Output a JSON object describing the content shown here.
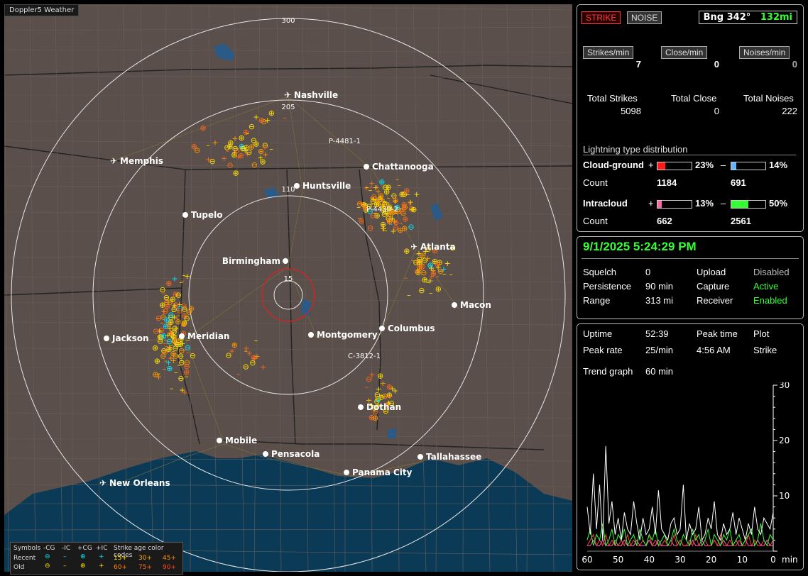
{
  "window_title": "Doppler5 Weather",
  "map": {
    "cities": [
      {
        "name": "Nashville",
        "airport": true
      },
      {
        "name": "Memphis",
        "airport": true
      },
      {
        "name": "Chattanooga",
        "airport": false
      },
      {
        "name": "Huntsville",
        "airport": false
      },
      {
        "name": "Tupelo",
        "airport": false
      },
      {
        "name": "Atlanta",
        "airport": true
      },
      {
        "name": "Birmingham",
        "airport": false
      },
      {
        "name": "Macon",
        "airport": false
      },
      {
        "name": "Jackson",
        "airport": false
      },
      {
        "name": "Meridian",
        "airport": false
      },
      {
        "name": "Montgomery",
        "airport": false
      },
      {
        "name": "Columbus",
        "airport": false
      },
      {
        "name": "Dothan",
        "airport": false
      },
      {
        "name": "Mobile",
        "airport": false
      },
      {
        "name": "Pensacola",
        "airport": false
      },
      {
        "name": "Tallahassee",
        "airport": false
      },
      {
        "name": "Panama City",
        "airport": false
      },
      {
        "name": "New Orleans",
        "airport": true
      }
    ],
    "ring_labels": [
      "300",
      "205",
      "110",
      "15"
    ],
    "cell_labels": [
      "P-4481-1",
      "P-4430-2",
      "C-3812-1"
    ],
    "colors": {
      "recent": "#00e5ff",
      "yellow": "#ffe000",
      "orange": "#ff9900",
      "deep_orange": "#ff6a1a"
    }
  },
  "legend": {
    "symbols_label": "Symbols",
    "cg_neg": "-CG",
    "ic_neg": "-IC",
    "cg_pos": "+CG",
    "ic_pos": "+IC",
    "age_title": "Strike age color codes",
    "recent": "Recent",
    "old": "Old",
    "ages_recent": [
      "15+",
      "30+",
      "45+"
    ],
    "ages_old": [
      "60+",
      "75+",
      "90+"
    ]
  },
  "header": {
    "strike_btn": "STRIKE",
    "noise_btn": "NOISE",
    "bng_label": "Bng 342°",
    "bng_dist": "132mi"
  },
  "rates": {
    "strikes_label": "Strikes/min",
    "strikes_value": "7",
    "close_label": "Close/min",
    "close_value": "0",
    "noises_label": "Noises/min",
    "noises_value": "0"
  },
  "totals": {
    "strikes_label": "Total Strikes",
    "strikes_value": "5098",
    "close_label": "Total Close",
    "close_value": "0",
    "noises_label": "Total Noises",
    "noises_value": "222"
  },
  "distribution": {
    "title": "Lightning type distribution",
    "cg_label": "Cloud-ground",
    "cg_pos_pct": "23%",
    "cg_neg_pct": "14%",
    "cg_pos_count": "1184",
    "cg_neg_count": "691",
    "ic_label": "Intracloud",
    "ic_pos_pct": "13%",
    "ic_neg_pct": "50%",
    "ic_pos_count": "662",
    "ic_neg_count": "2561",
    "count_label": "Count",
    "plus": "+",
    "minus": "–",
    "fill": {
      "cg_pos": 0.23,
      "cg_neg": 0.14,
      "ic_pos": 0.13,
      "ic_neg": 0.5
    }
  },
  "status": {
    "datetime": "9/1/2025 5:24:29 PM",
    "squelch_label": "Squelch",
    "squelch": "0",
    "persistence_label": "Persistence",
    "persistence": "90 min",
    "range_label": "Range",
    "range": "313 mi",
    "upload_label": "Upload",
    "upload": "Disabled",
    "capture_label": "Capture",
    "capture": "Active",
    "receiver_label": "Receiver",
    "receiver": "Enabled"
  },
  "stats": {
    "uptime_label": "Uptime",
    "uptime": "52:39",
    "peak_time_label": "Peak time",
    "peak_time": "4:56 AM",
    "plot_label": "Plot",
    "plot": "Strike",
    "peak_rate_label": "Peak rate",
    "peak_rate": "25/min",
    "trend_label": "Trend graph",
    "trend": "60 min"
  },
  "chart_data": {
    "type": "line",
    "x_ticks": [
      "60",
      "50",
      "40",
      "30",
      "20",
      "10",
      "0"
    ],
    "x_unit": "min",
    "y_ticks": [
      "30",
      "20",
      "10"
    ],
    "xlim": [
      60,
      0
    ],
    "ylim": [
      0,
      30
    ],
    "series": [
      {
        "color": "#ffffff",
        "values": [
          8,
          3,
          14,
          4,
          12,
          2,
          19,
          5,
          9,
          3,
          6,
          2,
          7,
          4,
          3,
          9,
          5,
          2,
          6,
          3,
          4,
          8,
          3,
          11,
          4,
          3,
          2,
          5,
          6,
          3,
          4,
          12,
          2,
          5,
          3,
          4,
          8,
          2,
          3,
          6,
          4,
          9,
          3,
          2,
          5,
          3,
          4,
          7,
          3,
          6,
          4,
          2,
          5,
          3,
          8,
          4,
          3,
          6,
          5,
          4,
          7
        ]
      },
      {
        "color": "#33ff33",
        "values": [
          2,
          4,
          1,
          3,
          2,
          5,
          1,
          2,
          4,
          1,
          3,
          2,
          4,
          1,
          2,
          3,
          1,
          4,
          2,
          1,
          3,
          2,
          4,
          1,
          2,
          3,
          1,
          2,
          4,
          2,
          1,
          3,
          2,
          1,
          4,
          2,
          3,
          1,
          2,
          4,
          1,
          3,
          2,
          1,
          3,
          2,
          4,
          1,
          2,
          3,
          1,
          2,
          3,
          4,
          1,
          2,
          5,
          2,
          1,
          3,
          2
        ]
      },
      {
        "color": "#ff4040",
        "values": [
          1,
          2,
          3,
          1,
          2,
          1,
          3,
          1,
          2,
          1,
          1,
          2,
          1,
          3,
          1,
          2,
          1,
          1,
          2,
          1,
          3,
          1,
          2,
          1,
          1,
          2,
          1,
          1,
          3,
          1,
          2,
          1,
          1,
          2,
          1,
          3,
          1,
          1,
          2,
          1,
          1,
          2,
          1,
          3,
          1,
          1,
          2,
          1,
          1,
          2,
          1,
          1,
          3,
          1,
          2,
          1,
          1,
          2,
          1,
          1,
          2
        ]
      },
      {
        "color": "#ff66cc",
        "values": [
          1,
          1,
          2,
          1,
          1,
          2,
          1,
          1,
          1,
          2,
          1,
          1,
          2,
          1,
          1,
          1,
          2,
          1,
          1,
          1,
          2,
          1,
          1,
          2,
          1,
          1,
          1,
          2,
          1,
          1,
          2,
          1,
          1,
          1,
          2,
          1,
          1,
          2,
          1,
          1,
          1,
          2,
          1,
          1,
          2,
          1,
          1,
          1,
          2,
          1,
          1,
          2,
          1,
          1,
          1,
          2,
          1,
          1,
          2,
          1,
          1
        ]
      }
    ]
  }
}
